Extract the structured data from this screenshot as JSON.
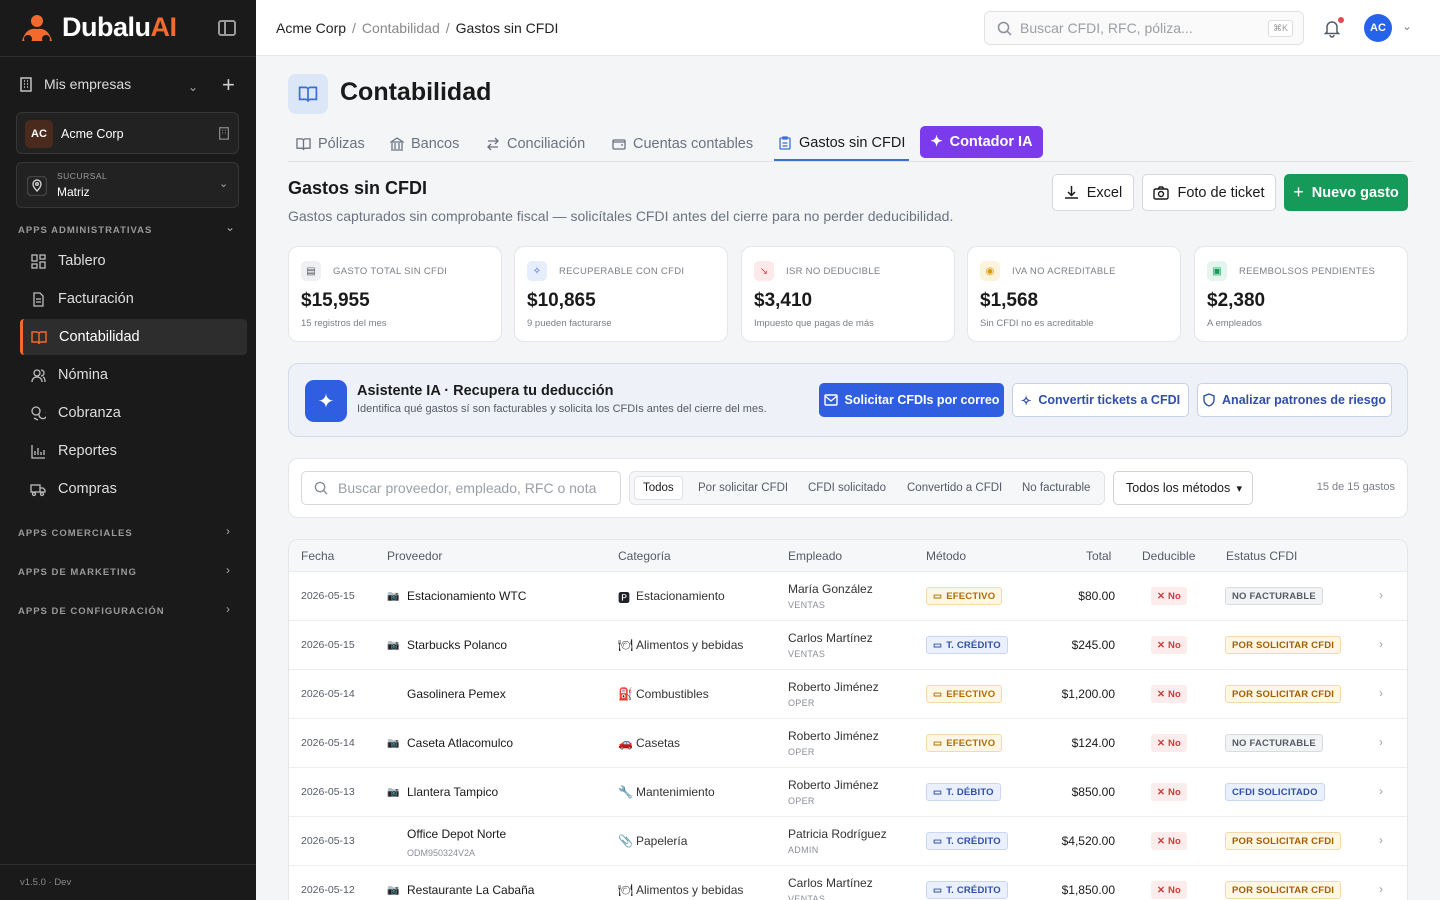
{
  "app": {
    "logo_main": "Dubalu",
    "logo_accent": "AI",
    "version": "v1.5.0 · Dev"
  },
  "sidebar": {
    "mis_empresas": "Mis empresas",
    "company": {
      "initials": "AC",
      "name": "Acme Corp"
    },
    "branch": {
      "label": "SUCURSAL",
      "value": "Matriz"
    },
    "section_admin": "APPS ADMINISTRATIVAS",
    "items": [
      {
        "label": "Tablero",
        "icon": "dashboard-icon"
      },
      {
        "label": "Facturación",
        "icon": "invoice-icon"
      },
      {
        "label": "Contabilidad",
        "icon": "book-icon"
      },
      {
        "label": "Nómina",
        "icon": "users-icon"
      },
      {
        "label": "Cobranza",
        "icon": "coins-icon"
      },
      {
        "label": "Reportes",
        "icon": "bar-chart-icon"
      },
      {
        "label": "Compras",
        "icon": "truck-icon"
      }
    ],
    "section_comerciales": "APPS COMERCIALES",
    "section_marketing": "APPS DE MARKETING",
    "section_config": "APPS DE CONFIGURACIÓN"
  },
  "topbar": {
    "breadcrumb": [
      "Acme Corp",
      "/",
      "Contabilidad",
      "/",
      "Gastos sin CFDI"
    ],
    "search_placeholder": "Buscar CFDI, RFC, póliza...",
    "search_shortcut": "⌘K",
    "user_initials": "AC"
  },
  "page": {
    "title": "Contabilidad",
    "tabs": [
      "Pólizas",
      "Bancos",
      "Conciliación",
      "Cuentas contables",
      "Gastos sin CFDI"
    ],
    "tab_ai": "Contador IA",
    "section_title": "Gastos sin CFDI",
    "section_subtitle": "Gastos capturados sin comprobante fiscal — solicítales CFDI antes del cierre para no perder deducibilidad.",
    "btn_excel": "Excel",
    "btn_photo": "Foto de ticket",
    "btn_new": "Nuevo gasto"
  },
  "kpis": [
    {
      "label": "GASTO TOTAL SIN CFDI",
      "value": "$15,955",
      "sub": "15 registros del mes",
      "color": "#6b7280"
    },
    {
      "label": "RECUPERABLE CON CFDI",
      "value": "$10,865",
      "sub": "9 pueden facturarse",
      "color": "#2f5fe0"
    },
    {
      "label": "ISR NO DEDUCIBLE",
      "value": "$3,410",
      "sub": "Impuesto que pagas de más",
      "color": "#e5484d"
    },
    {
      "label": "IVA NO ACREDITABLE",
      "value": "$1,568",
      "sub": "Sin CFDI no es acreditable",
      "color": "#d99a0b"
    },
    {
      "label": "REEMBOLSOS PENDIENTES",
      "value": "$2,380",
      "sub": "A empleados",
      "color": "#169a5a"
    }
  ],
  "ai_banner": {
    "title": "Asistente IA · Recupera tu deducción",
    "subtitle": "Identifica qué gastos sí son facturables y solicita los CFDIs antes del cierre del mes.",
    "btn_request": "Solicitar CFDIs por correo",
    "btn_convert": "Convertir tickets a CFDI",
    "btn_analyze": "Analizar patrones de riesgo"
  },
  "filters": {
    "search_placeholder": "Buscar proveedor, empleado, RFC o nota",
    "segments": [
      "Todos",
      "Por solicitar CFDI",
      "CFDI solicitado",
      "Convertido a CFDI",
      "No facturable"
    ],
    "method_select": "Todos los métodos",
    "count": "15 de 15 gastos"
  },
  "table": {
    "headers": [
      "Fecha",
      "Proveedor",
      "Categoría",
      "Empleado",
      "Método",
      "Total",
      "Deducible",
      "Estatus CFDI"
    ],
    "rows": [
      {
        "date": "2026-05-15",
        "provider": "Estacionamiento WTC",
        "provider_sub": "",
        "has_icon": true,
        "cat_icon": "🅿",
        "category": "Estacionamiento",
        "employee": "María González",
        "dept": "VENTAS",
        "method": "EFECTIVO",
        "method_type": "cash",
        "total": "$80.00",
        "deductible": "✕ No",
        "status": "NO FACTURABLE",
        "status_type": "nofac"
      },
      {
        "date": "2026-05-15",
        "provider": "Starbucks Polanco",
        "provider_sub": "",
        "has_icon": true,
        "cat_icon": "🍽",
        "category": "Alimentos y bebidas",
        "employee": "Carlos Martínez",
        "dept": "VENTAS",
        "method": "T. CRÉDITO",
        "method_type": "card",
        "total": "$245.00",
        "deductible": "✕ No",
        "status": "POR SOLICITAR CFDI",
        "status_type": "sol"
      },
      {
        "date": "2026-05-14",
        "provider": "Gasolinera Pemex",
        "provider_sub": "",
        "has_icon": false,
        "cat_icon": "⛽",
        "category": "Combustibles",
        "employee": "Roberto Jiménez",
        "dept": "OPER",
        "method": "EFECTIVO",
        "method_type": "cash",
        "total": "$1,200.00",
        "deductible": "✕ No",
        "status": "POR SOLICITAR CFDI",
        "status_type": "sol"
      },
      {
        "date": "2026-05-14",
        "provider": "Caseta Atlacomulco",
        "provider_sub": "",
        "has_icon": true,
        "cat_icon": "🚗",
        "category": "Casetas",
        "employee": "Roberto Jiménez",
        "dept": "OPER",
        "method": "EFECTIVO",
        "method_type": "cash",
        "total": "$124.00",
        "deductible": "✕ No",
        "status": "NO FACTURABLE",
        "status_type": "nofac"
      },
      {
        "date": "2026-05-13",
        "provider": "Llantera Tampico",
        "provider_sub": "",
        "has_icon": true,
        "cat_icon": "🔧",
        "category": "Mantenimiento",
        "employee": "Roberto Jiménez",
        "dept": "OPER",
        "method": "T. DÉBITO",
        "method_type": "card",
        "total": "$850.00",
        "deductible": "✕ No",
        "status": "CFDI SOLICITADO",
        "status_type": "req"
      },
      {
        "date": "2026-05-13",
        "provider": "Office Depot Norte",
        "provider_sub": "ODM950324V2A",
        "has_icon": false,
        "cat_icon": "📎",
        "category": "Papelería",
        "employee": "Patricia Rodríguez",
        "dept": "ADMIN",
        "method": "T. CRÉDITO",
        "method_type": "card",
        "total": "$4,520.00",
        "deductible": "✕ No",
        "status": "POR SOLICITAR CFDI",
        "status_type": "sol"
      },
      {
        "date": "2026-05-12",
        "provider": "Restaurante La Cabaña",
        "provider_sub": "",
        "has_icon": true,
        "cat_icon": "🍽",
        "category": "Alimentos y bebidas",
        "employee": "Carlos Martínez",
        "dept": "VENTAS",
        "method": "T. CRÉDITO",
        "method_type": "card",
        "total": "$1,850.00",
        "deductible": "✕ No",
        "status": "POR SOLICITAR CFDI",
        "status_type": "sol"
      }
    ]
  }
}
